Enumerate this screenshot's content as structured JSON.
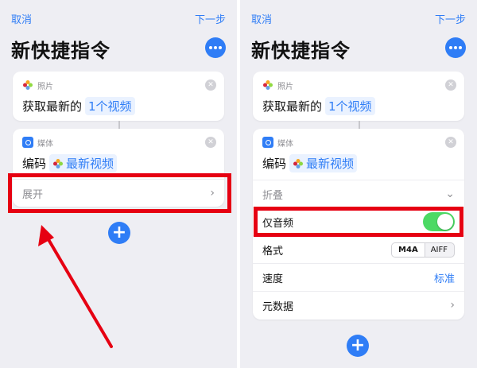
{
  "nav": {
    "cancel": "取消",
    "next": "下一步"
  },
  "title": "新快捷指令",
  "card_photos": {
    "app_label": "照片",
    "action_text": "获取最新的",
    "token": "1个视频"
  },
  "card_media": {
    "app_label": "媒体",
    "action_text": "编码",
    "token": "最新视频"
  },
  "left_panel": {
    "expand_label": "展开"
  },
  "right_panel": {
    "collapse_label": "折叠",
    "audio_only_label": "仅音频",
    "audio_only_on": true,
    "format_label": "格式",
    "format_options": [
      "M4A",
      "AIFF"
    ],
    "format_selected": "M4A",
    "speed_label": "速度",
    "speed_value": "标准",
    "metadata_label": "元数据"
  },
  "colors": {
    "accent": "#2f7df6",
    "highlight": "#e60012",
    "toggle_on": "#4cd964"
  },
  "icons": {
    "more": "ellipsis-icon",
    "close": "close-x-icon",
    "add": "plus-icon",
    "chevron": "chevron-icon"
  }
}
